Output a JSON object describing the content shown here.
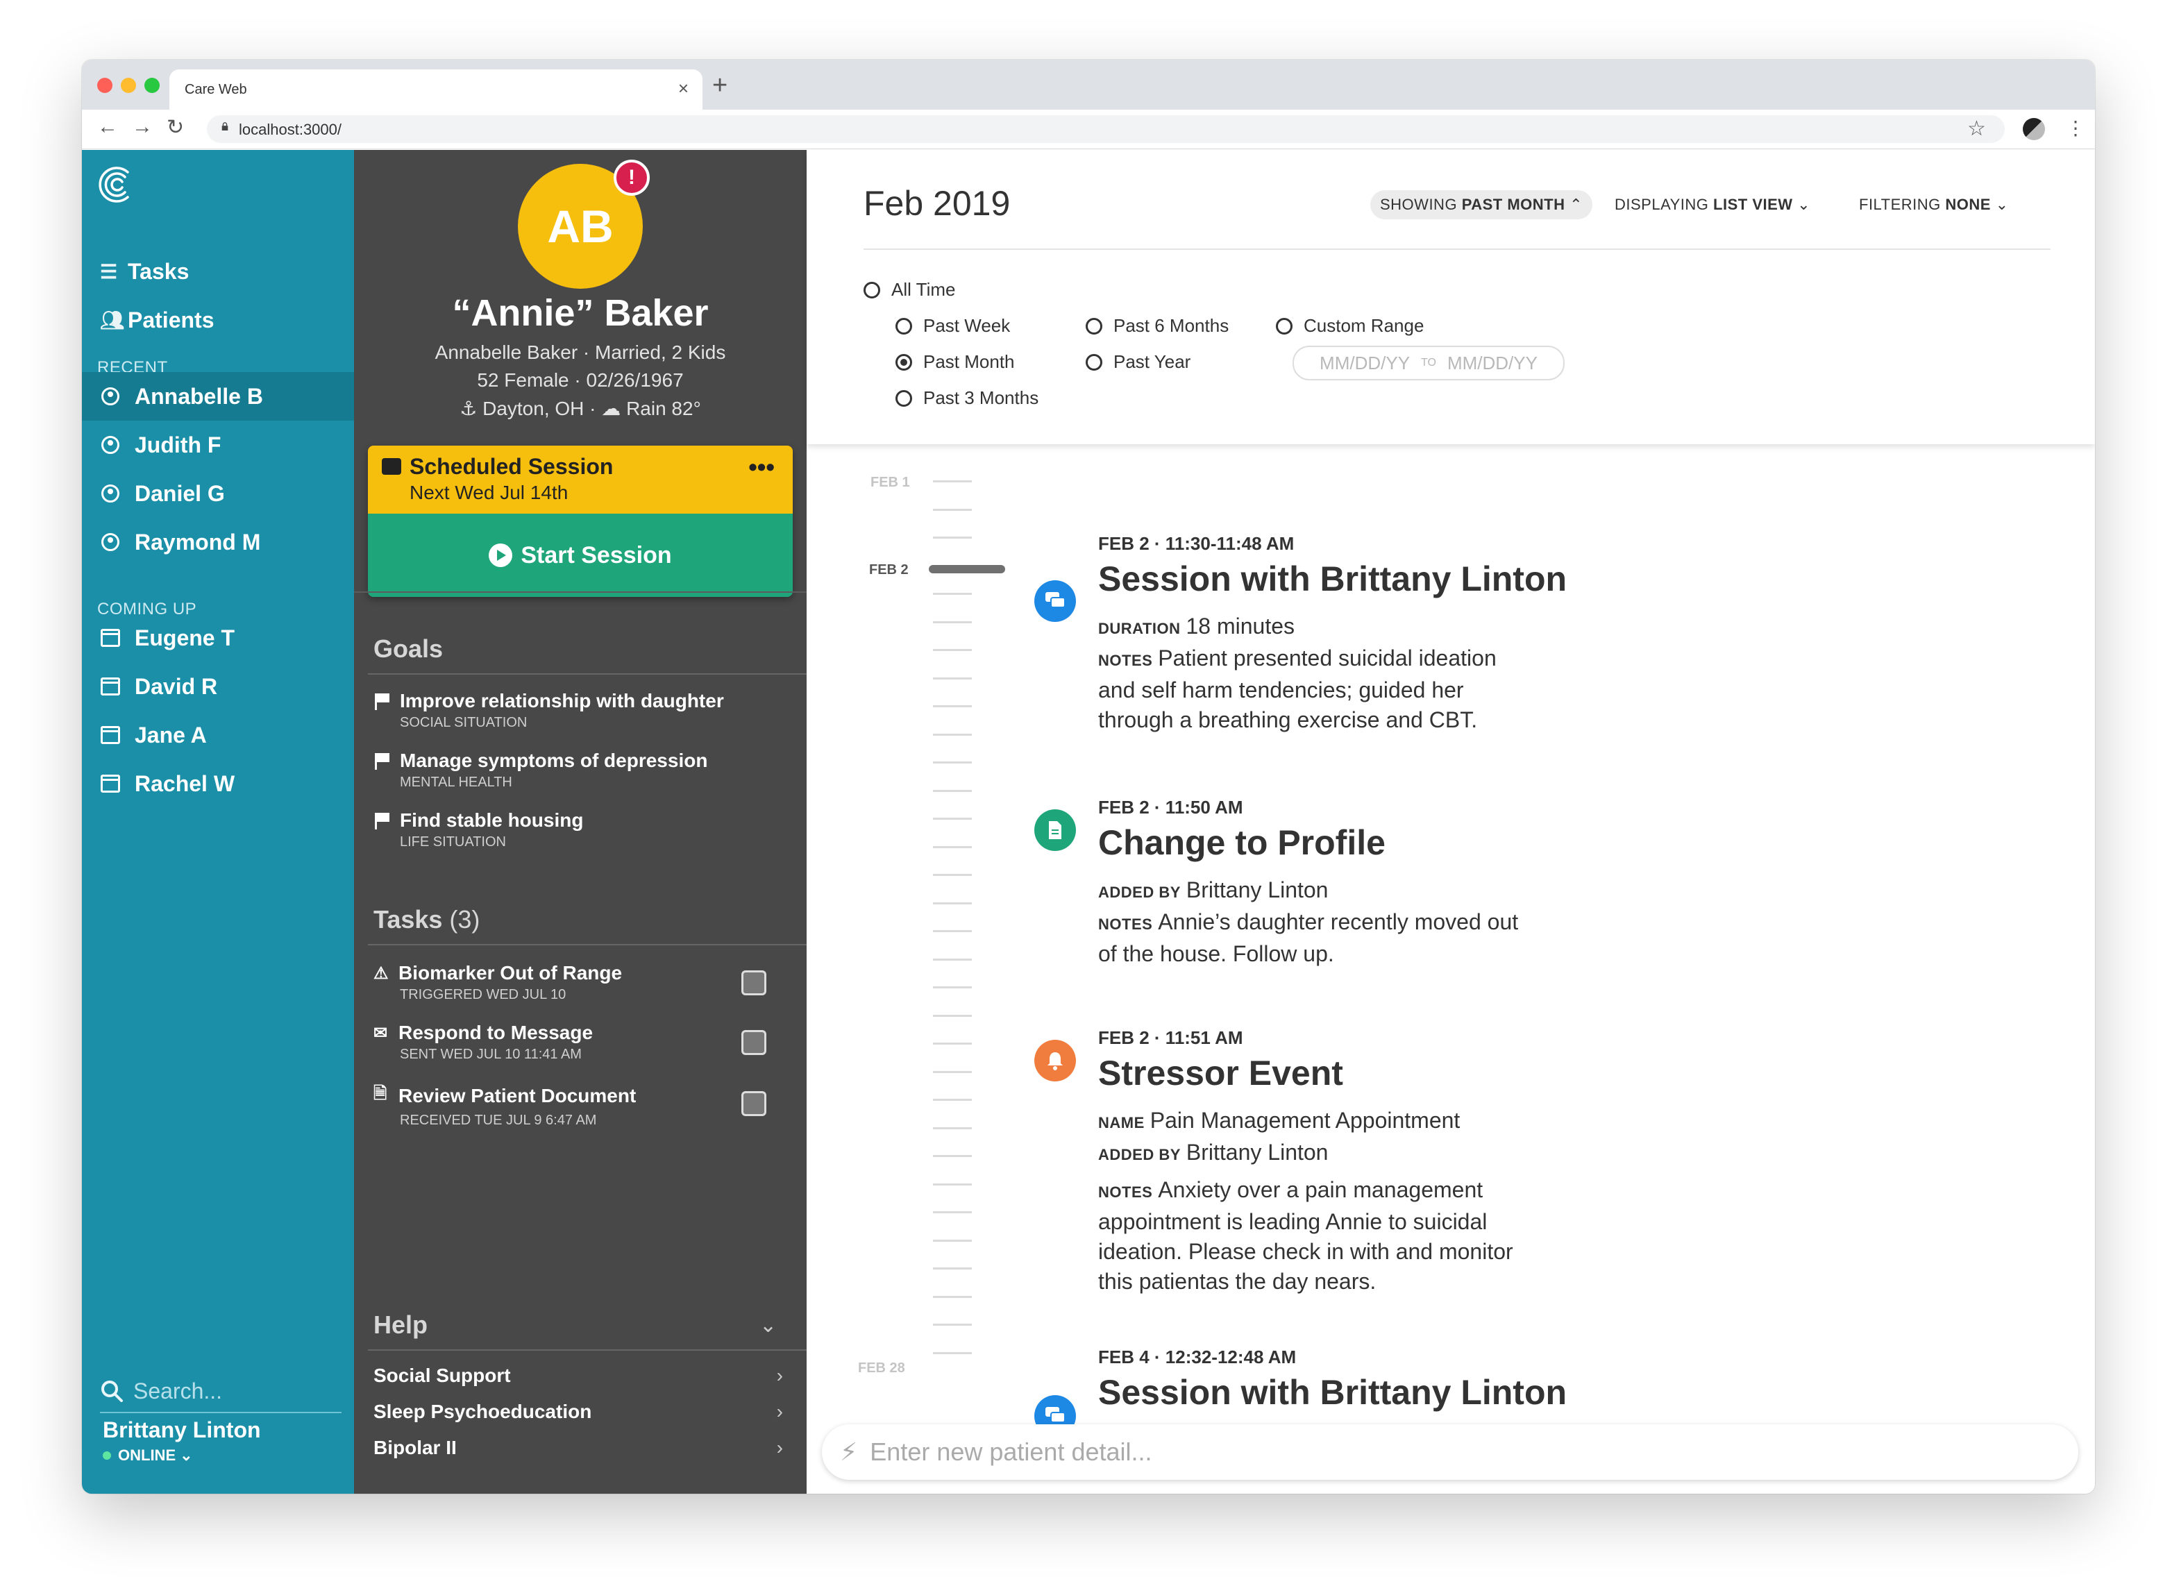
{
  "browser": {
    "tab_title": "Care Web",
    "url": "localhost:3000/"
  },
  "sidebar": {
    "nav": [
      {
        "label": "Tasks",
        "icon": "list-icon"
      },
      {
        "label": "Patients",
        "icon": "people-icon"
      }
    ],
    "recent_label": "RECENT",
    "recent": [
      "Annabelle B",
      "Judith F",
      "Daniel G",
      "Raymond M"
    ],
    "active_recent": "Annabelle B",
    "coming_up_label": "COMING UP",
    "coming_up": [
      "Eugene T",
      "David R",
      "Jane A",
      "Rachel W"
    ],
    "search_placeholder": "Search...",
    "user_name": "Brittany Linton",
    "user_status": "ONLINE"
  },
  "patient": {
    "initials": "AB",
    "alert": "!",
    "display_name": "“Annie” Baker",
    "line1": "Annabelle Baker · Married, 2 Kids",
    "line2": "52 Female · 02/26/1967",
    "location": "Dayton, OH",
    "weather": "Rain 82°",
    "session": {
      "title": "Scheduled Session",
      "when": "Next Wed Jul 14th",
      "more": "•••",
      "start_label": "Start Session"
    },
    "goals_header": "Goals",
    "goals": [
      {
        "title": "Improve relationship with daughter",
        "category": "SOCIAL SITUATION"
      },
      {
        "title": "Manage symptoms of depression",
        "category": "MENTAL HEALTH"
      },
      {
        "title": "Find stable housing",
        "category": "LIFE SITUATION"
      }
    ],
    "tasks_header": "Tasks",
    "tasks_count": "(3)",
    "tasks": [
      {
        "title": "Biomarker Out of Range",
        "sub": "TRIGGERED WED JUL 10",
        "icon": "warning-icon"
      },
      {
        "title": "Respond to Message",
        "sub": "SENT WED JUL 10 11:41 AM",
        "icon": "envelope-icon"
      },
      {
        "title": "Review Patient Document",
        "sub": "RECEIVED TUE JUL 9 6:47 AM",
        "icon": "document-icon"
      }
    ],
    "help_header": "Help",
    "help_items": [
      "Social Support",
      "Sleep Psychoeducation",
      "Bipolar II"
    ]
  },
  "main": {
    "month": "Feb 2019",
    "filters": {
      "showing_prefix": "SHOWING",
      "showing_value": "PAST MONTH",
      "displaying_prefix": "DISPLAYING",
      "displaying_value": "LIST VIEW",
      "filtering_prefix": "FILTERING",
      "filtering_value": "NONE"
    },
    "range_options": {
      "all_time": "All Time",
      "past_week": "Past Week",
      "past_month": "Past Month",
      "past_3_months": "Past 3 Months",
      "past_6_months": "Past 6 Months",
      "past_year": "Past Year",
      "custom_range": "Custom Range"
    },
    "selected_range": "Past Month",
    "date_from_placeholder": "MM/DD/YY",
    "date_to_label": "TO",
    "date_to_placeholder": "MM/DD/YY",
    "timeline_labels": {
      "start": "FEB 1",
      "current": "FEB 2",
      "end": "FEB 28"
    },
    "events": [
      {
        "date": "FEB 2 · 11:30-11:48 AM",
        "title": "Session with Brittany Linton",
        "icon": "chat-icon",
        "color": "#1e88e5",
        "fields": [
          {
            "key": "DURATION",
            "value": "18 minutes"
          },
          {
            "key": "NOTES",
            "value": "Patient presented suicidal ideation and self harm tendencies; guided her through a breathing exercise and CBT."
          }
        ]
      },
      {
        "date": "FEB 2 · 11:50 AM",
        "title": "Change to Profile",
        "icon": "document-icon",
        "color": "#1ea67a",
        "fields": [
          {
            "key": "ADDED BY",
            "value": "Brittany Linton"
          },
          {
            "key": "NOTES",
            "value": "Annie’s daughter recently moved out of the house. Follow up."
          }
        ]
      },
      {
        "date": "FEB 2 · 11:51 AM",
        "title": "Stressor Event",
        "icon": "bell-icon",
        "color": "#f07d3e",
        "fields": [
          {
            "key": "NAME",
            "value": "Pain Management Appointment"
          },
          {
            "key": "ADDED BY",
            "value": "Brittany Linton"
          },
          {
            "key": "NOTES",
            "value": "Anxiety over a pain management appointment is leading Annie to suicidal ideation. Please check in with and monitor this patientas the day nears."
          }
        ]
      },
      {
        "date": "FEB 4 · 12:32-12:48 AM",
        "title": "Session with Brittany Linton",
        "icon": "chat-icon",
        "color": "#1e88e5",
        "fields": []
      }
    ],
    "input_placeholder": "Enter new patient detail..."
  }
}
